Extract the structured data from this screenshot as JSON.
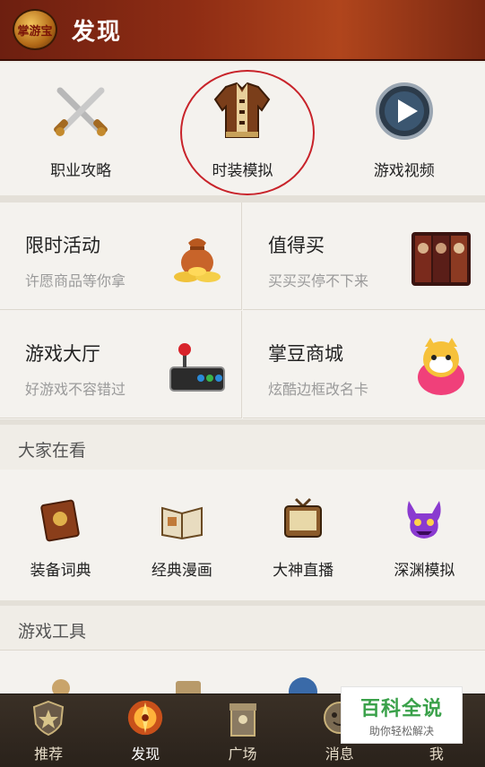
{
  "header": {
    "title": "发现",
    "logo_text": "掌游宝"
  },
  "top_items": [
    {
      "label": "职业攻略",
      "icon": "crossed-swords-icon"
    },
    {
      "label": "时装模拟",
      "icon": "costume-icon"
    },
    {
      "label": "游戏视频",
      "icon": "play-video-icon"
    }
  ],
  "cards": [
    {
      "title": "限时活动",
      "subtitle": "许愿商品等你拿",
      "icon": "gold-bag-icon"
    },
    {
      "title": "值得买",
      "subtitle": "买买买停不下来",
      "icon": "game-art-icon"
    },
    {
      "title": "游戏大厅",
      "subtitle": "好游戏不容错过",
      "icon": "joystick-icon"
    },
    {
      "title": "掌豆商城",
      "subtitle": "炫酷边框改名卡",
      "icon": "mascot-icon"
    }
  ],
  "sections": {
    "watching": "大家在看",
    "tools": "游戏工具"
  },
  "watching_items": [
    {
      "label": "装备词典",
      "icon": "book-icon"
    },
    {
      "label": "经典漫画",
      "icon": "open-book-icon"
    },
    {
      "label": "大神直播",
      "icon": "tv-icon"
    },
    {
      "label": "深渊模拟",
      "icon": "demon-icon"
    }
  ],
  "bottom_nav": [
    {
      "label": "推荐",
      "icon": "shield-icon"
    },
    {
      "label": "发现",
      "icon": "compass-icon",
      "active": true
    },
    {
      "label": "广场",
      "icon": "tower-icon"
    },
    {
      "label": "消息",
      "icon": "message-icon"
    },
    {
      "label": "我",
      "icon": "profile-icon"
    }
  ],
  "watermark": {
    "line1": "百科全说",
    "line2": "助你轻松解决"
  },
  "colors": {
    "header": "#8f2d14",
    "highlight_circle": "#c8232a",
    "nav_bg": "#2a221b",
    "watermark_green": "#3aa14a"
  }
}
